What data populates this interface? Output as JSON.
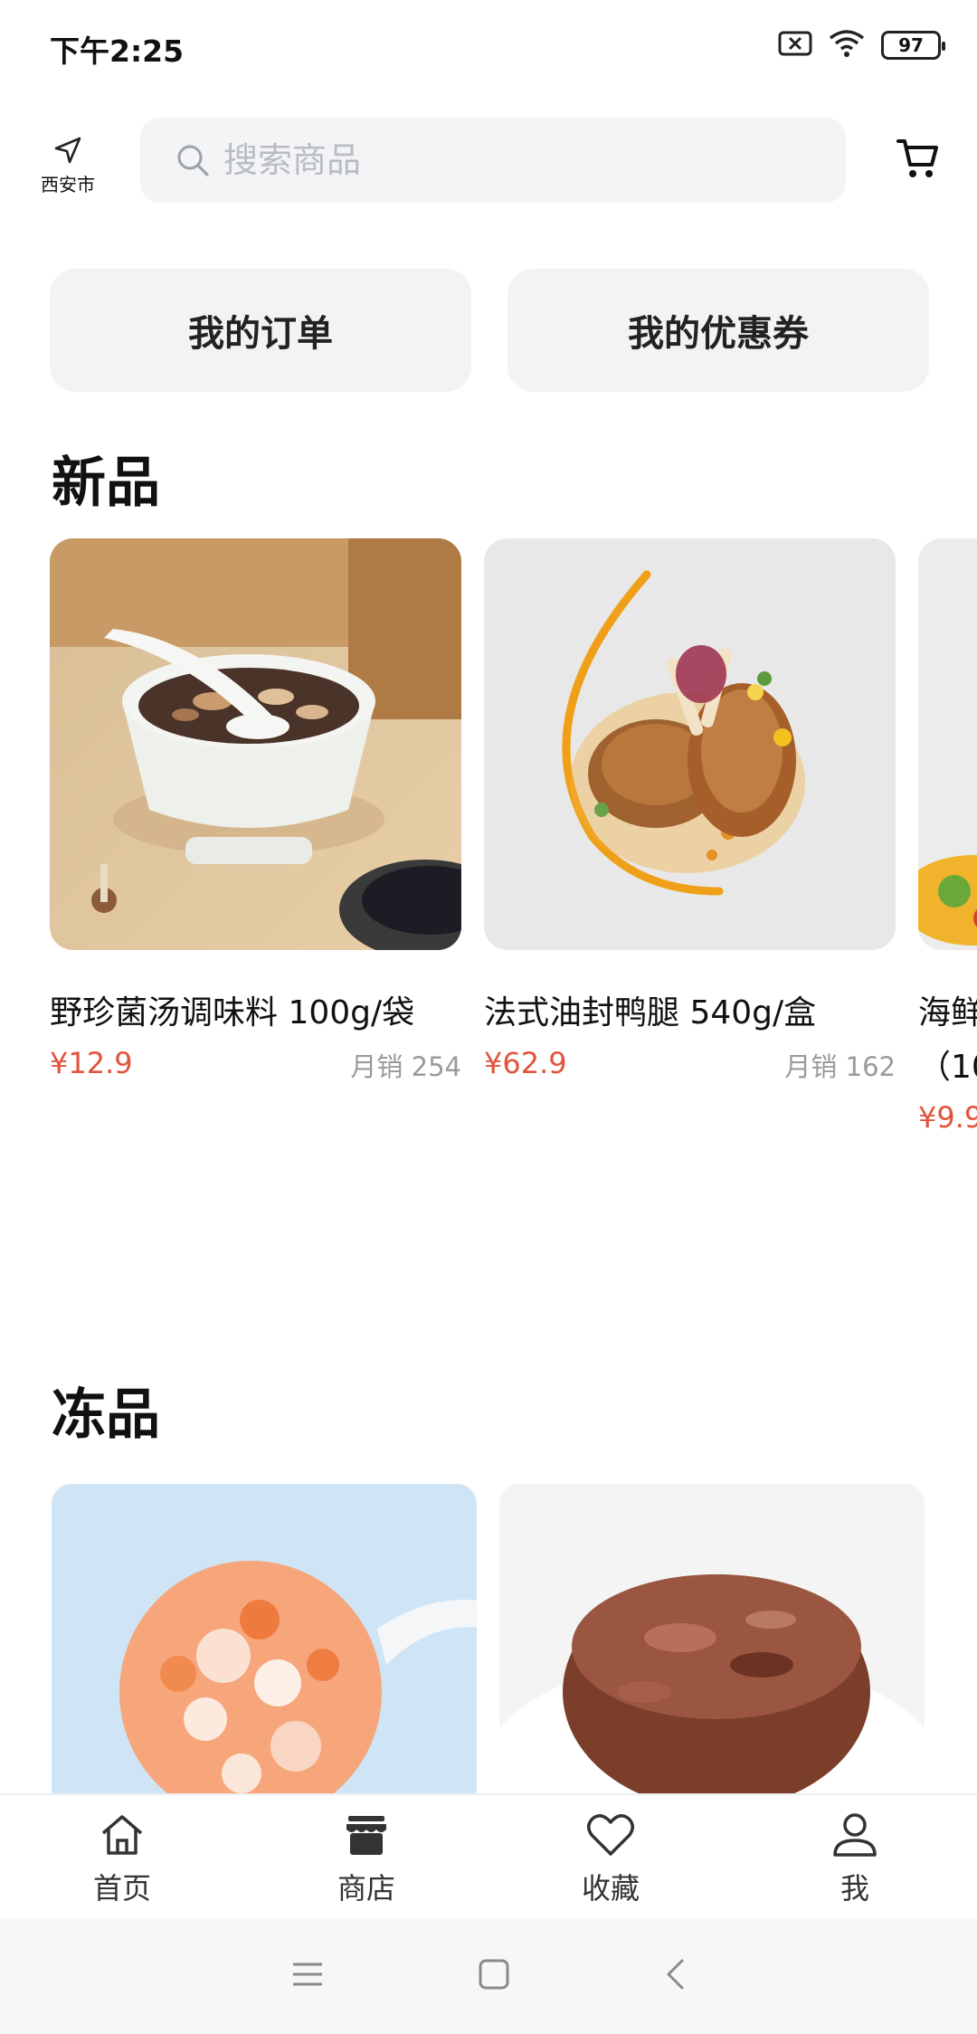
{
  "status_bar": {
    "time": "下午2:25",
    "battery": "97"
  },
  "header": {
    "location": "西安市",
    "search_placeholder": "搜索商品"
  },
  "quick_actions": {
    "orders": "我的订单",
    "coupons": "我的优惠券"
  },
  "sections": {
    "new_title": "新品",
    "frozen_title": "冻品"
  },
  "new_products": [
    {
      "name": "野珍菌汤调味料 100g/袋",
      "price": "¥12.9",
      "sales": "月销 254"
    },
    {
      "name": "法式油封鸭腿 540g/盒",
      "price": "¥62.9",
      "sales": "月销 162"
    },
    {
      "name": "海鲜",
      "name_line2": "（10",
      "price": "¥9.9"
    }
  ],
  "tabbar": {
    "home": "首页",
    "shop": "商店",
    "favorites": "收藏",
    "me": "我"
  },
  "colors": {
    "price": "#e0543c",
    "card_bg": "#f3f3f3"
  }
}
